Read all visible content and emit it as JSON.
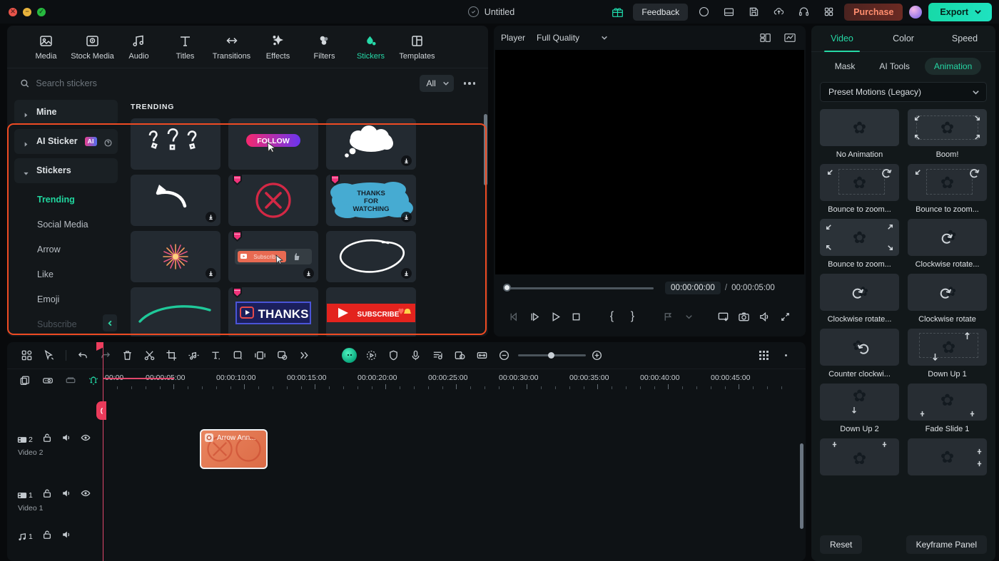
{
  "titlebar": {
    "project_title": "Untitled",
    "feedback_label": "Feedback",
    "purchase_label": "Purchase",
    "export_label": "Export",
    "icons": [
      "gift-icon",
      "record-icon",
      "layout-icon",
      "save-icon",
      "cloud-upload-icon",
      "support-icon",
      "apps-grid-icon"
    ]
  },
  "nav": {
    "tabs": [
      {
        "label": "Media",
        "icon": "media-icon"
      },
      {
        "label": "Stock Media",
        "icon": "stock-media-icon"
      },
      {
        "label": "Audio",
        "icon": "audio-icon"
      },
      {
        "label": "Titles",
        "icon": "titles-icon"
      },
      {
        "label": "Transitions",
        "icon": "transitions-icon"
      },
      {
        "label": "Effects",
        "icon": "effects-icon"
      },
      {
        "label": "Filters",
        "icon": "filters-icon"
      },
      {
        "label": "Stickers",
        "icon": "stickers-icon"
      },
      {
        "label": "Templates",
        "icon": "templates-icon"
      }
    ],
    "active": "Stickers"
  },
  "search": {
    "placeholder": "Search stickers",
    "value": "",
    "filter_label": "All"
  },
  "library": {
    "section_label": "TRENDING",
    "groups": [
      {
        "label": "Mine",
        "expanded": false,
        "badge": ""
      },
      {
        "label": "AI Sticker",
        "expanded": false,
        "badge": "AI"
      },
      {
        "label": "Stickers",
        "expanded": true,
        "badge": ""
      }
    ],
    "categories": [
      {
        "label": "Trending",
        "active": true
      },
      {
        "label": "Social Media",
        "active": false
      },
      {
        "label": "Arrow",
        "active": false
      },
      {
        "label": "Like",
        "active": false
      },
      {
        "label": "Emoji",
        "active": false
      },
      {
        "label": "Subscribe",
        "active": false
      }
    ],
    "stickers": [
      {
        "name": "question-marks",
        "pro": false,
        "download": false
      },
      {
        "name": "follow-button",
        "pro": false,
        "download": false
      },
      {
        "name": "thought-cloud",
        "pro": false,
        "download": true
      },
      {
        "name": "curved-arrow",
        "pro": false,
        "download": true
      },
      {
        "name": "red-x-circle",
        "pro": true,
        "download": false
      },
      {
        "name": "thanks-for-watching",
        "pro": true,
        "download": true,
        "text": "THANKS FOR WATCHING"
      },
      {
        "name": "firework",
        "pro": false,
        "download": true
      },
      {
        "name": "subscribe-button",
        "pro": true,
        "download": true,
        "text": "Subscribe"
      },
      {
        "name": "circle-scribble",
        "pro": false,
        "download": true
      },
      {
        "name": "teal-underline",
        "pro": false,
        "download": false
      },
      {
        "name": "thanks-banner",
        "pro": true,
        "download": false,
        "text": "THANKS"
      },
      {
        "name": "subscribe-bar",
        "pro": false,
        "download": false,
        "text": "SUBSCRIBE"
      }
    ]
  },
  "player": {
    "title": "Player",
    "quality": "Full Quality",
    "current_time": "00:00:00:00",
    "separator": "/",
    "total_time": "00:00:05:00",
    "controls": [
      "prev-frame-icon",
      "step-frame-icon",
      "play-icon",
      "stop-icon",
      "mark-in-icon",
      "mark-out-icon",
      "markers-icon",
      "markers-dropdown-icon",
      "fit-screen-icon",
      "snapshot-icon",
      "volume-icon",
      "fullscreen-icon"
    ]
  },
  "properties": {
    "tabs": [
      {
        "label": "Video",
        "active": true
      },
      {
        "label": "Color",
        "active": false
      },
      {
        "label": "Speed",
        "active": false
      }
    ],
    "subtabs": [
      {
        "label": "Mask",
        "active": false
      },
      {
        "label": "AI Tools",
        "active": false
      },
      {
        "label": "Animation",
        "active": true
      }
    ],
    "preset_group": "Preset Motions (Legacy)",
    "presets": [
      {
        "label": "No Animation",
        "icon": "none"
      },
      {
        "label": "Boom!",
        "icon": "zoom-out-corners"
      },
      {
        "label": "Bounce to zoom...",
        "icon": "bounce-tl-tr"
      },
      {
        "label": "Bounce to zoom...",
        "icon": "bounce-tl-tr"
      },
      {
        "label": "Bounce to zoom...",
        "icon": "bounce-four"
      },
      {
        "label": "Clockwise rotate...",
        "icon": "rotate-cw"
      },
      {
        "label": "Clockwise rotate...",
        "icon": "rotate-cw"
      },
      {
        "label": "Clockwise rotate",
        "icon": "rotate-cw"
      },
      {
        "label": "Counter clockwi...",
        "icon": "rotate-ccw"
      },
      {
        "label": "Down Up 1",
        "icon": "down-up"
      },
      {
        "label": "Down Up 2",
        "icon": "down"
      },
      {
        "label": "Fade Slide 1",
        "icon": "fade-bottom"
      },
      {
        "label": "",
        "icon": "fade-top"
      },
      {
        "label": "",
        "icon": "fade-right"
      }
    ],
    "reset_label": "Reset",
    "keyframe_label": "Keyframe Panel"
  },
  "timeline": {
    "toolbar_left": [
      "layout-grid-icon",
      "cursor-select-icon",
      "undo-icon",
      "redo-icon",
      "delete-icon",
      "split-icon",
      "crop-icon",
      "audio-detach-icon",
      "text-icon",
      "overlay-icon",
      "transition-icon",
      "mask-icon",
      "more-icon"
    ],
    "toolbar_right": [
      "ai-copilot-icon",
      "auto-reframe-icon",
      "stabilize-icon",
      "voiceover-icon",
      "audio-mix-icon",
      "screen-record-icon",
      "fit-timeline-icon",
      "zoom-out-icon",
      "zoom-in-icon",
      "marker-grid-icon"
    ],
    "track_icons": [
      "add-track-icon",
      "link-icon",
      "group-icon",
      "magnet-icon"
    ],
    "ruler_ticks": [
      "00:00",
      "00:00:05:00",
      "00:00:10:00",
      "00:00:15:00",
      "00:00:20:00",
      "00:00:25:00",
      "00:00:30:00",
      "00:00:35:00",
      "00:00:40:00",
      "00:00:45:00"
    ],
    "tracks": [
      {
        "type": "video",
        "num": "2",
        "name": "Video 2"
      },
      {
        "type": "video",
        "num": "1",
        "name": "Video 1"
      },
      {
        "type": "audio",
        "num": "1",
        "name": ""
      }
    ],
    "clip": {
      "label": "Arrow Ann...",
      "track": "Video 2"
    }
  }
}
